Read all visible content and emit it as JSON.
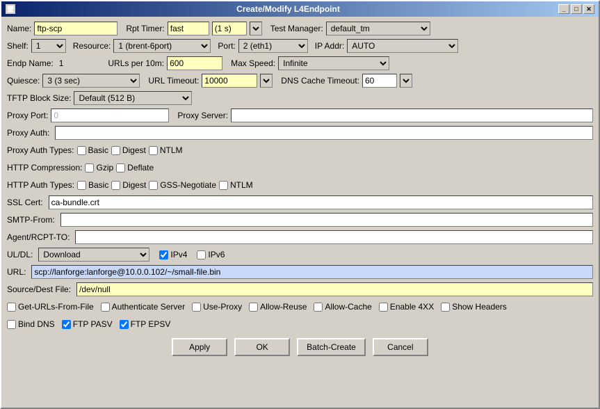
{
  "window": {
    "title": "Create/Modify L4Endpoint",
    "minimize_label": "_",
    "maximize_label": "□",
    "close_label": "✕"
  },
  "form": {
    "name_label": "Name:",
    "name_value": "ftp-scp",
    "rpt_timer_label": "Rpt Timer:",
    "rpt_timer_value": "fast",
    "rpt_timer_suffix": "(1 s)",
    "test_manager_label": "Test Manager:",
    "test_manager_value": "default_tm",
    "shelf_label": "Shelf:",
    "shelf_value": "1",
    "resource_label": "Resource:",
    "resource_value": "1 (brent-6port)",
    "port_label": "Port:",
    "port_value": "2 (eth1)",
    "ip_addr_label": "IP Addr:",
    "ip_addr_value": "AUTO",
    "endp_name_label": "Endp Name:",
    "endp_name_value": "1",
    "urls_per_10m_label": "URLs per 10m:",
    "urls_per_10m_value": "600",
    "max_speed_label": "Max Speed:",
    "max_speed_value": "Infinite",
    "quiesce_label": "Quiesce:",
    "quiesce_value": "3 (3 sec)",
    "url_timeout_label": "URL Timeout:",
    "url_timeout_value": "10000",
    "dns_cache_timeout_label": "DNS Cache Timeout:",
    "dns_cache_timeout_value": "60",
    "tftp_block_size_label": "TFTP Block Size:",
    "tftp_block_size_value": "Default (512 B)",
    "proxy_port_label": "Proxy Port:",
    "proxy_port_value": "0",
    "proxy_server_label": "Proxy Server:",
    "proxy_server_value": "",
    "proxy_auth_label": "Proxy Auth:",
    "proxy_auth_value": "",
    "proxy_auth_types_label": "Proxy Auth Types:",
    "basic_label": "Basic",
    "digest_label": "Digest",
    "ntlm_label": "NTLM",
    "http_compression_label": "HTTP Compression:",
    "gzip_label": "Gzip",
    "deflate_label": "Deflate",
    "http_auth_types_label": "HTTP Auth Types:",
    "basic2_label": "Basic",
    "digest2_label": "Digest",
    "gss_negotiate_label": "GSS-Negotiate",
    "ntlm2_label": "NTLM",
    "ssl_cert_label": "SSL Cert:",
    "ssl_cert_value": "ca-bundle.crt",
    "smtp_from_label": "SMTP-From:",
    "smtp_from_value": "",
    "agent_rcpt_to_label": "Agent/RCPT-TO:",
    "agent_rcpt_to_value": "",
    "ul_dl_label": "UL/DL:",
    "ul_dl_value": "Download",
    "ipv4_label": "IPv4",
    "ipv6_label": "IPv6",
    "url_label": "URL:",
    "url_value": "scp://lanforge:lanforge@10.0.0.102/~/small-file.bin",
    "source_dest_label": "Source/Dest File:",
    "source_dest_value": "/dev/null",
    "get_urls_from_file_label": "Get-URLs-From-File",
    "authenticate_server_label": "Authenticate Server",
    "use_proxy_label": "Use-Proxy",
    "allow_reuse_label": "Allow-Reuse",
    "allow_cache_label": "Allow-Cache",
    "enable_4xx_label": "Enable 4XX",
    "show_headers_label": "Show Headers",
    "bind_dns_label": "Bind DNS",
    "ftp_pasv_label": "FTP PASV",
    "ftp_epsv_label": "FTP EPSV",
    "apply_label": "Apply",
    "ok_label": "OK",
    "batch_create_label": "Batch-Create",
    "cancel_label": "Cancel"
  }
}
